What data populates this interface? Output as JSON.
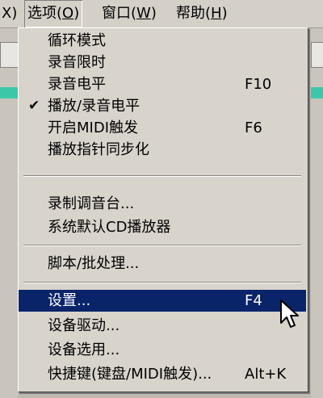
{
  "menubar": {
    "items": [
      {
        "label": "X)",
        "mnemonic": ""
      },
      {
        "label": "选项(",
        "mnemonic": "O",
        "close": ")"
      },
      {
        "label": "窗口(",
        "mnemonic": "W",
        "close": ")"
      },
      {
        "label": "帮助(",
        "mnemonic": "H",
        "close": ")"
      }
    ]
  },
  "menu": {
    "items": [
      {
        "label": "循环模式",
        "shortcut": "",
        "checked": false
      },
      {
        "label": "录音限时",
        "shortcut": "",
        "checked": false
      },
      {
        "label": "录音电平",
        "shortcut": "F10",
        "checked": false
      },
      {
        "label": "播放/录音电平",
        "shortcut": "",
        "checked": true
      },
      {
        "label": "开启MIDI触发",
        "shortcut": "F6",
        "checked": false
      },
      {
        "label": "播放指针同步化",
        "shortcut": "",
        "checked": false
      },
      {
        "label": "录制调音台...",
        "shortcut": "",
        "checked": false
      },
      {
        "label": "系统默认CD播放器",
        "shortcut": "",
        "checked": false
      },
      {
        "label": "脚本/批处理...",
        "shortcut": "",
        "checked": false
      },
      {
        "label": "设置...",
        "shortcut": "F4",
        "checked": false
      },
      {
        "label": "设备驱动...",
        "shortcut": "",
        "checked": false
      },
      {
        "label": "设备选用...",
        "shortcut": "",
        "checked": false
      },
      {
        "label": "快捷键(键盘/MIDI触发)...",
        "shortcut": "Alt+K",
        "checked": false
      }
    ],
    "check_glyph": "✔"
  },
  "colors": {
    "highlight": "#0a246a",
    "menu_bg": "#d8d4cc",
    "accent_teal": "#3cc8a8"
  }
}
